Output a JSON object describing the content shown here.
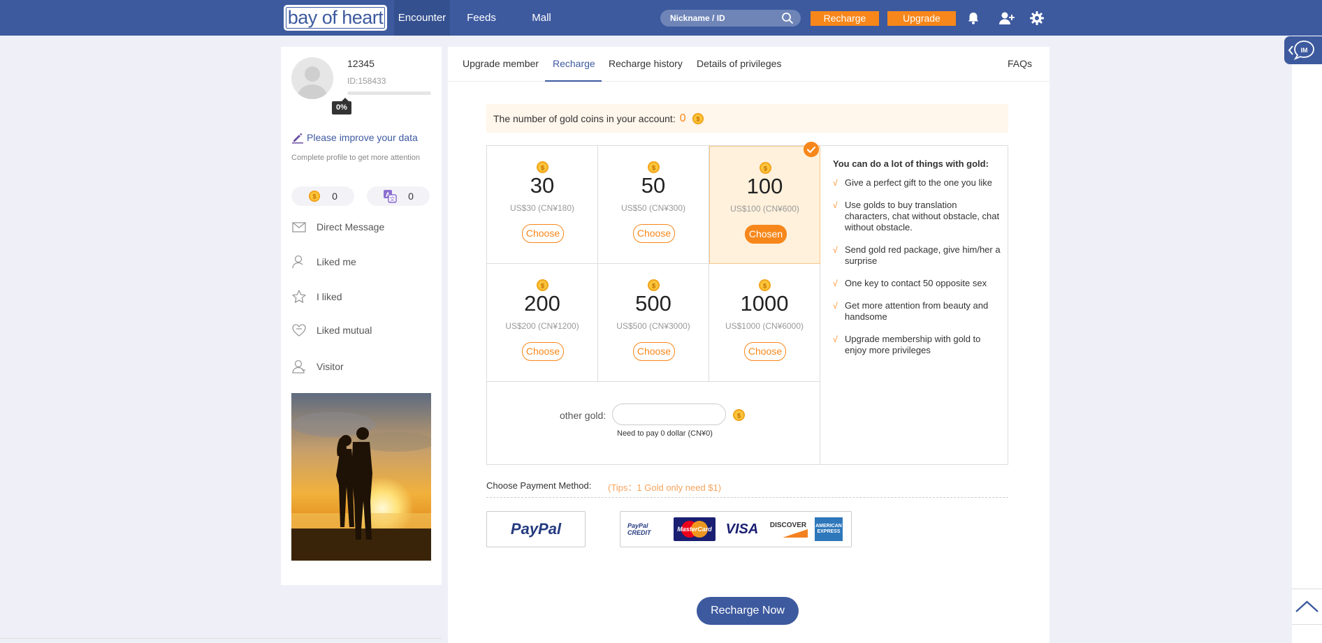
{
  "header": {
    "logo_text": "bay of heart",
    "nav": {
      "encounter": "Encounter",
      "feeds": "Feeds",
      "mall": "Mall"
    },
    "search_placeholder": "Nickname / ID",
    "recharge_label": "Recharge",
    "upgrade_label": "Upgrade",
    "icons": [
      "search-icon",
      "bell-icon",
      "add-user-icon",
      "gear-icon"
    ]
  },
  "profile": {
    "username": "12345",
    "user_id": "ID:158433",
    "completion_percent": 0,
    "completion_label": "0%",
    "improve_link": "Please improve your data",
    "improve_hint": "Complete profile to get more attention",
    "gold_count": "0",
    "translation_count": "0"
  },
  "sidebar": {
    "items": [
      {
        "label": "Direct Message",
        "icon": "envelope-icon"
      },
      {
        "label": "Liked me",
        "icon": "user-icon"
      },
      {
        "label": "I liked",
        "icon": "star-icon"
      },
      {
        "label": "Liked mutual",
        "icon": "heart-icon"
      },
      {
        "label": "Visitor",
        "icon": "visitor-icon"
      }
    ]
  },
  "tabs": {
    "upgrade_member": "Upgrade member",
    "recharge": "Recharge",
    "recharge_history": "Recharge history",
    "details_of_privileges": "Details of privileges",
    "faqs": "FAQs",
    "active": "recharge"
  },
  "account": {
    "label": "The number of gold coins in your account:",
    "coins": "0"
  },
  "packages": [
    {
      "amount": "30",
      "price": "US$30 (CN¥180)",
      "button": "Choose",
      "chosen": false
    },
    {
      "amount": "50",
      "price": "US$50 (CN¥300)",
      "button": "Choose",
      "chosen": false
    },
    {
      "amount": "100",
      "price": "US$100 (CN¥600)",
      "button": "Chosen",
      "chosen": true
    },
    {
      "amount": "200",
      "price": "US$200 (CN¥1200)",
      "button": "Choose",
      "chosen": false
    },
    {
      "amount": "500",
      "price": "US$500 (CN¥3000)",
      "button": "Choose",
      "chosen": false
    },
    {
      "amount": "1000",
      "price": "US$1000 (CN¥6000)",
      "button": "Choose",
      "chosen": false
    }
  ],
  "other_gold": {
    "label": "other gold:",
    "value": "",
    "need_to_pay": "Need to pay 0 dollar (CN¥0)"
  },
  "perks": {
    "title": "You can do a lot of things with gold:",
    "tick": "√",
    "items": [
      "Give a perfect gift to the one you like",
      "Use golds to buy translation characters, chat without obstacle, chat without obstacle.",
      "Send gold red package, give him/her a surprise",
      "One key to contact 50 opposite sex",
      "Get more attention from beauty and handsome",
      "Upgrade membership with gold to enjoy more privileges"
    ]
  },
  "payment": {
    "label": "Choose Payment Method:",
    "tips": "(Tips：1 Gold only need $1)",
    "paypal": "PayPal",
    "cards": {
      "paypal_credit": "PayPal CREDIT",
      "mastercard": "MasterCard",
      "visa": "VISA",
      "discover": "DISCOVER",
      "amex": "AMERICAN EXPRESS"
    }
  },
  "recharge_now": "Recharge Now",
  "im_label": "IM",
  "colors": {
    "brand": "#3d5a9f",
    "accent": "#f7871a",
    "chosen_bg": "#fff1dc",
    "banner_bg": "#fff6ec"
  }
}
